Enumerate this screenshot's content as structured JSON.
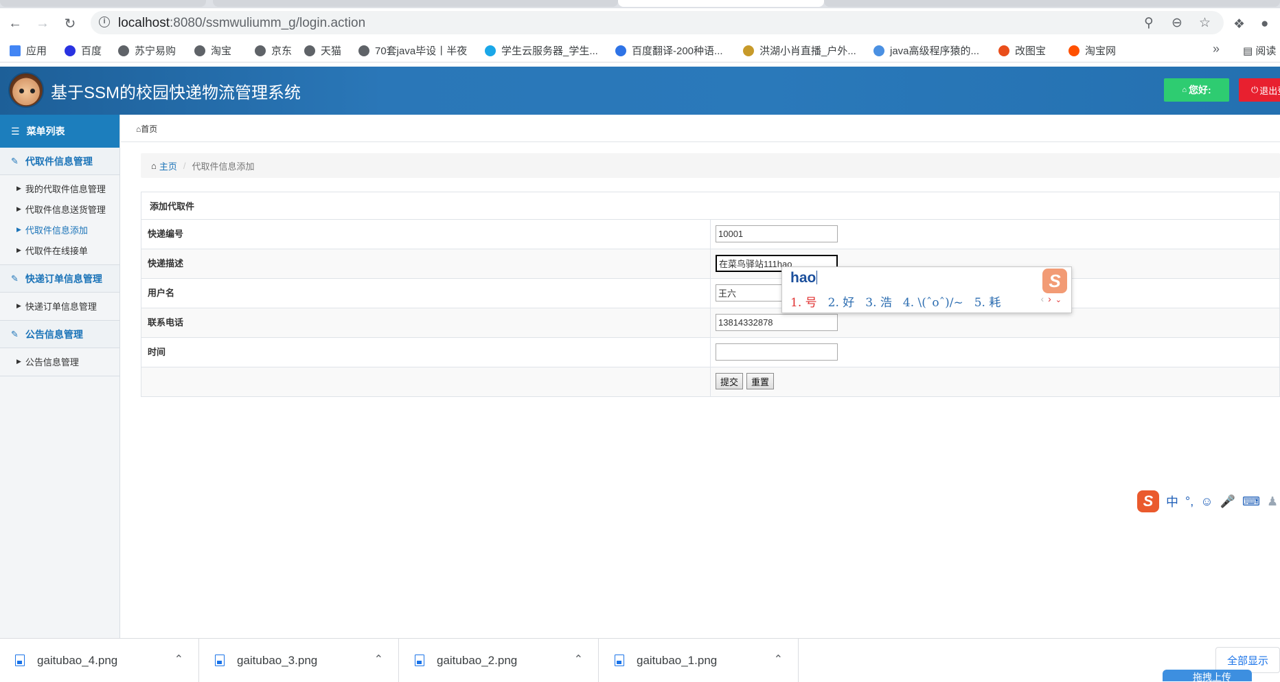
{
  "browser": {
    "url_host": "localhost",
    "url_path": ":8080/ssmwuliumm_g/login.action",
    "bookmarks": [
      {
        "label": "应用",
        "color": "#4285f4"
      },
      {
        "label": "百度",
        "color": "#2932e1"
      },
      {
        "label": "苏宁易购",
        "color": "#5f6368"
      },
      {
        "label": "淘宝",
        "color": "#5f6368"
      },
      {
        "label": "京东",
        "color": "#5f6368"
      },
      {
        "label": "天猫",
        "color": "#5f6368"
      },
      {
        "label": "70套java毕设丨半夜",
        "color": "#5f6368"
      },
      {
        "label": "学生云服务器_学生...",
        "color": "#1aa7e8"
      },
      {
        "label": "百度翻译-200种语...",
        "color": "#2e73e6"
      },
      {
        "label": "洪湖小肖直播_户外...",
        "color": "#c79a2a"
      },
      {
        "label": "java高级程序猿的...",
        "color": "#4a90e2"
      },
      {
        "label": "改图宝",
        "color": "#e94e1b"
      },
      {
        "label": "淘宝网",
        "color": "#ff5000"
      }
    ],
    "bookmarks_more": "»",
    "reading_list": "阅读"
  },
  "header": {
    "title": "基于SSM的校园快递物流管理系统",
    "hello": "您好:",
    "logout": "退出登录"
  },
  "sidebar": {
    "menu_title": "菜单列表",
    "groups": [
      {
        "label": "代取件信息管理",
        "items": [
          "我的代取件信息管理",
          "代取件信息送货管理",
          "代取件信息添加",
          "代取件在线接单"
        ]
      },
      {
        "label": "快递订单信息管理",
        "items": [
          "快递订单信息管理"
        ]
      },
      {
        "label": "公告信息管理",
        "items": [
          "公告信息管理"
        ]
      }
    ]
  },
  "topnav": {
    "home": "首页"
  },
  "breadcrumb": {
    "home": "主页",
    "current": "代取件信息添加"
  },
  "form": {
    "title": "添加代取件",
    "fields": [
      {
        "label": "快递编号",
        "value": "10001"
      },
      {
        "label": "快递描述",
        "value": "在菜鸟驿站111hao"
      },
      {
        "label": "用户名",
        "value": "王六"
      },
      {
        "label": "联系电话",
        "value": "13814332878"
      },
      {
        "label": "时间",
        "value": ""
      }
    ],
    "submit": "提交",
    "reset": "重置"
  },
  "ime": {
    "composition": "hao",
    "candidates": [
      "1. 号",
      "2. 好",
      "3. 浩",
      "4. \\(ˆoˆ)/~",
      "5. 耗"
    ],
    "logo": "S"
  },
  "imebar": {
    "mode": "中",
    "punct": "°,"
  },
  "downloads": {
    "files": [
      "gaitubao_4.png",
      "gaitubao_3.png",
      "gaitubao_2.png",
      "gaitubao_1.png"
    ],
    "show_all": "全部显示",
    "drag_upload": "拖拽上传"
  }
}
